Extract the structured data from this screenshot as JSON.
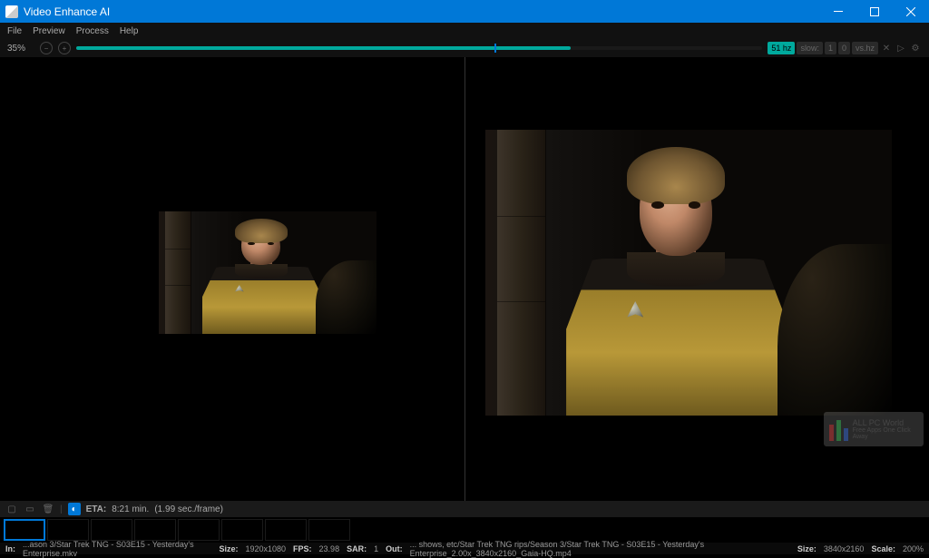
{
  "window": {
    "title": "Video Enhance AI"
  },
  "menu": {
    "file": "File",
    "preview": "Preview",
    "process": "Process",
    "help": "Help"
  },
  "toolbar": {
    "percent": "35%",
    "progress_fill_pct": 72,
    "progress_marker_pct": 61,
    "btn1": "51 hz",
    "btn2": "slow:",
    "btn2v": "1",
    "btn3": "0",
    "btn4": "vs.hz"
  },
  "eta": {
    "label": "ETA:",
    "value": "8:21 min.",
    "rate": "(1.99 sec./frame)"
  },
  "status": {
    "in_lbl": "In:",
    "in_path": "...ason 3/Star Trek TNG - S03E15 - Yesterday's Enterprise.mkv",
    "size_in_lbl": "Size:",
    "size_in": "1920x1080",
    "fps_lbl": "FPS:",
    "fps": "23.98",
    "sar_lbl": "SAR:",
    "sar": "1",
    "out_lbl": "Out:",
    "out_path": "... shows, etc/Star Trek TNG rips/Season 3/Star Trek TNG - S03E15 - Yesterday's Enterprise_2.00x_3840x2160_Gaia-HQ.mp4",
    "size_out_lbl": "Size:",
    "size_out": "3840x2160",
    "scale_lbl": "Scale:",
    "scale": "200%"
  },
  "watermark": {
    "line1": "ALL PC World",
    "line2": "Free Apps One Click Away"
  }
}
